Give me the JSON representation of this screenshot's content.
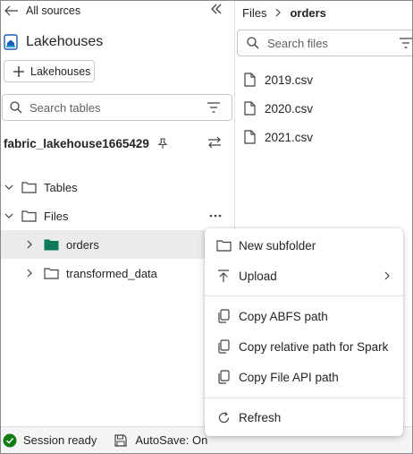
{
  "left": {
    "back_link": "All sources",
    "title": "Lakehouses",
    "add_button": "Lakehouses",
    "search_placeholder": "Search tables",
    "lakehouse_name": "fabric_lakehouse1665429",
    "tree": {
      "tables": "Tables",
      "files": "Files",
      "orders": "orders",
      "transformed": "transformed_data"
    }
  },
  "right": {
    "breadcrumb_root": "Files",
    "breadcrumb_current": "orders",
    "search_placeholder": "Search files",
    "files": [
      "2019.csv",
      "2020.csv",
      "2021.csv"
    ]
  },
  "menu": {
    "new_subfolder": "New subfolder",
    "upload": "Upload",
    "copy_abfs": "Copy ABFS path",
    "copy_relative": "Copy relative path for Spark",
    "copy_file_api": "Copy File API path",
    "refresh": "Refresh"
  },
  "status": {
    "session": "Session ready",
    "autosave": "AutoSave: On"
  },
  "colors": {
    "accent_green": "#107c10",
    "folder_selected": "#0e7a5a",
    "selection_bg": "#ebebeb"
  }
}
